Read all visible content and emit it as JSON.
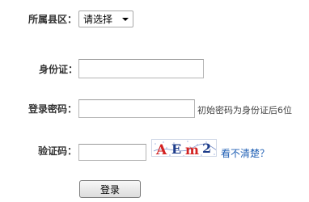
{
  "form": {
    "county": {
      "label": "所属县区：",
      "selected": "请选择"
    },
    "id_card": {
      "label": "身份证：",
      "value": ""
    },
    "password": {
      "label": "登录密码：",
      "value": "",
      "hint": "初始密码为身份证后6位"
    },
    "captcha": {
      "label": "验证码：",
      "value": "",
      "image_text": "AEm2",
      "refresh_link": "看不清楚？"
    },
    "login_button": "登录"
  },
  "colors": {
    "link": "#1f5fb4",
    "captcha_text": "#d32222",
    "captcha_dark": "#1d3c8a"
  }
}
